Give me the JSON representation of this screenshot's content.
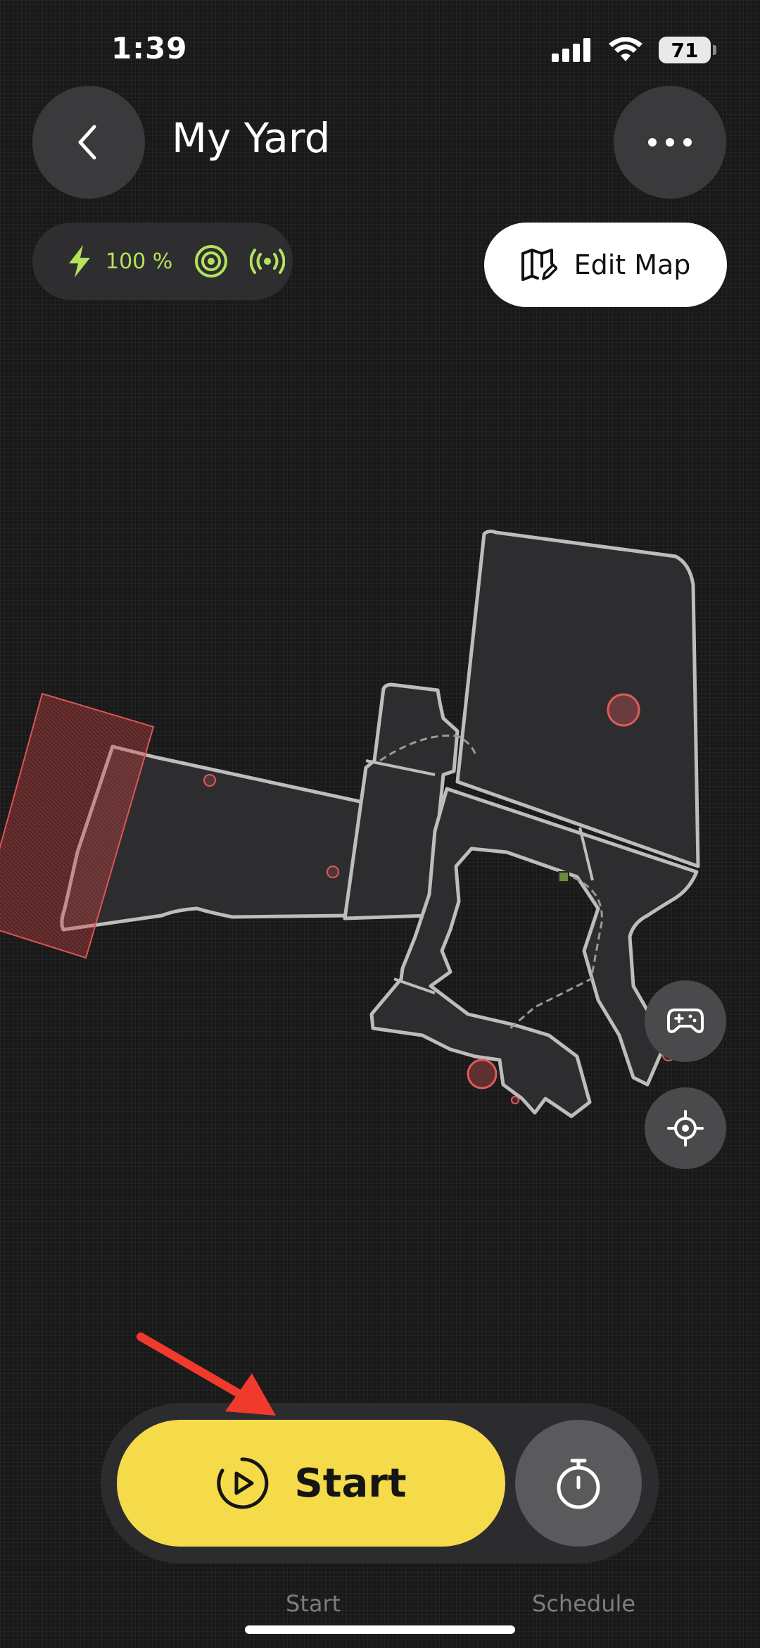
{
  "status_bar": {
    "time": "1:39",
    "battery": "71"
  },
  "header": {
    "title": "My Yard"
  },
  "status_chip": {
    "battery_percent": "100 %"
  },
  "edit_map": {
    "label": "Edit Map"
  },
  "primary_action": {
    "label": "Start"
  },
  "tabs": [
    {
      "label": "Start"
    },
    {
      "label": "Schedule"
    }
  ],
  "colors": {
    "background": "#19191a",
    "accent_yellow": "#f5db4a",
    "status_green": "#b4e35a",
    "zone_fill": "#2d2d2f",
    "zone_border": "#bdbdbd",
    "no_go_red": "#e05a5a",
    "annotation_arrow": "#f03a2e"
  },
  "icons": [
    "back-chevron-icon",
    "more-dots-icon",
    "lightning-icon",
    "rtk-signal-icon",
    "wireless-signal-icon",
    "map-edit-icon",
    "gamepad-icon",
    "locate-icon",
    "play-circle-icon",
    "stopwatch-icon"
  ]
}
